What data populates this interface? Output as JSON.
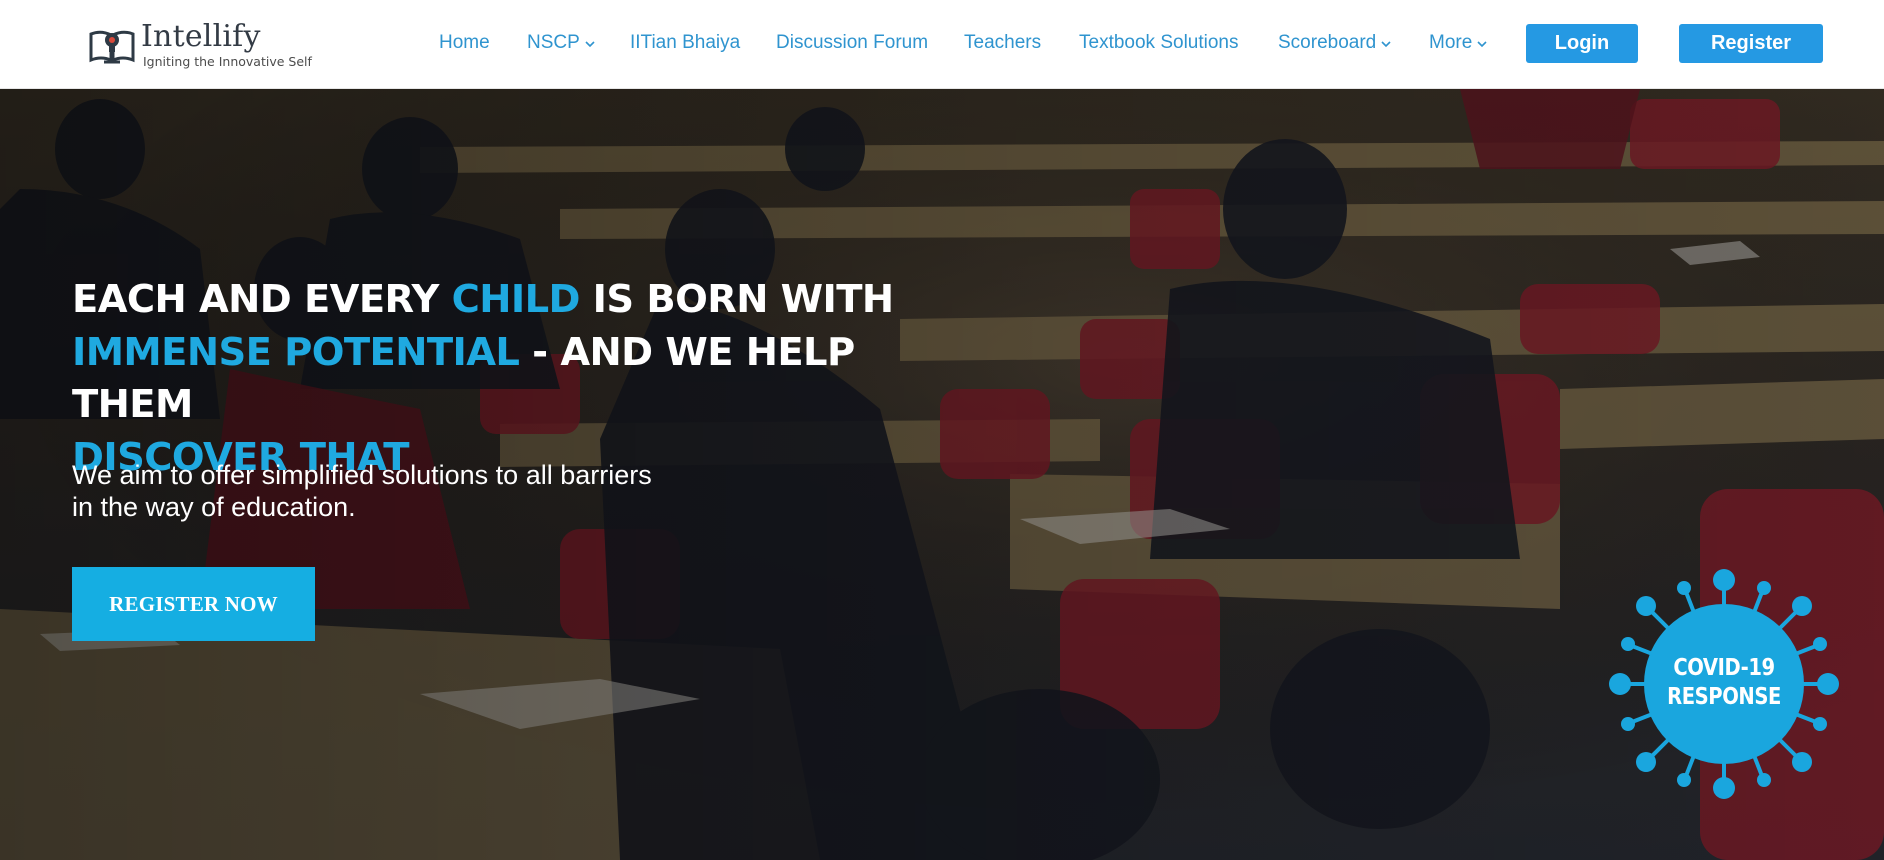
{
  "header": {
    "logo": {
      "name": "Intellify",
      "tagline": "Igniting the Innovative Self"
    },
    "nav": [
      {
        "label": "Home",
        "dropdown": false
      },
      {
        "label": "NSCP",
        "dropdown": true
      },
      {
        "label": "IITian Bhaiya",
        "dropdown": false
      },
      {
        "label": "Discussion Forum",
        "dropdown": false
      },
      {
        "label": "Teachers",
        "dropdown": false
      },
      {
        "label": "Textbook Solutions",
        "dropdown": false
      },
      {
        "label": "Scoreboard",
        "dropdown": true
      },
      {
        "label": "More",
        "dropdown": true
      }
    ],
    "login_label": "Login",
    "register_label": "Register"
  },
  "hero": {
    "headline": {
      "line1": {
        "a": "EACH AND EVERY ",
        "accent": "CHILD",
        "b": " IS BORN WITH"
      },
      "line2": {
        "accent": "IMMENSE POTENTIAL",
        "b": " - AND WE HELP THEM"
      },
      "line3": {
        "accent": "DISCOVER THAT"
      }
    },
    "subtext": {
      "line1": "We aim to offer simplified solutions to all barriers",
      "line2": "in the way of education."
    },
    "cta_label": "REGISTER NOW",
    "covid_badge": {
      "line1": "COVID-19",
      "line2": "RESPONSE"
    },
    "background_image": "classroom-exam-photo"
  },
  "colors": {
    "accent": "#1fa9e0",
    "nav_link": "#2f94cf",
    "button": "#2599e3",
    "cta": "#15aee2",
    "header_bg": "#ffffff"
  },
  "icons": {
    "logo": "book-lightbulb-icon",
    "caret": "chevron-down-icon",
    "covid": "virus-icon"
  }
}
